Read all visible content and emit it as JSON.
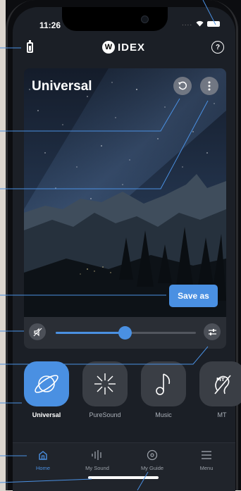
{
  "status_bar": {
    "time": "11:26",
    "signal": "...."
  },
  "header": {
    "logo_mark": "W",
    "logo_text": "IDEX",
    "help_label": "?"
  },
  "program_card": {
    "title": "Universal",
    "save_label": "Save as"
  },
  "volume": {
    "level": 0.49
  },
  "programs": [
    {
      "label": "Universal",
      "icon": "planet-icon",
      "active": true
    },
    {
      "label": "PureSound",
      "icon": "starburst-icon",
      "active": false
    },
    {
      "label": "Music",
      "icon": "music-note-icon",
      "active": false
    },
    {
      "label": "MT",
      "icon": "mt-ear-icon",
      "active": false
    }
  ],
  "tabs": [
    {
      "label": "Home",
      "icon": "home-icon",
      "active": true
    },
    {
      "label": "My Sound",
      "icon": "sound-bars-icon",
      "active": false
    },
    {
      "label": "My Guide",
      "icon": "compass-icon",
      "active": false
    },
    {
      "label": "Menu",
      "icon": "hamburger-icon",
      "active": false
    }
  ],
  "colors": {
    "accent": "#4a90e2",
    "background": "#1b1f26",
    "callout": "#4a90e2"
  }
}
